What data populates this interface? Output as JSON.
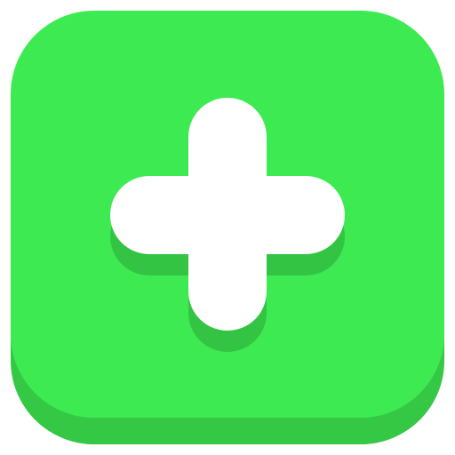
{
  "icon": {
    "name": "plus-icon",
    "shape": "rounded-square-button-with-plus",
    "colors": {
      "face": "#3EEA52",
      "base_shadow": "#34C845",
      "symbol": "#FFFFFF",
      "symbol_shadow": "#33C444"
    }
  }
}
